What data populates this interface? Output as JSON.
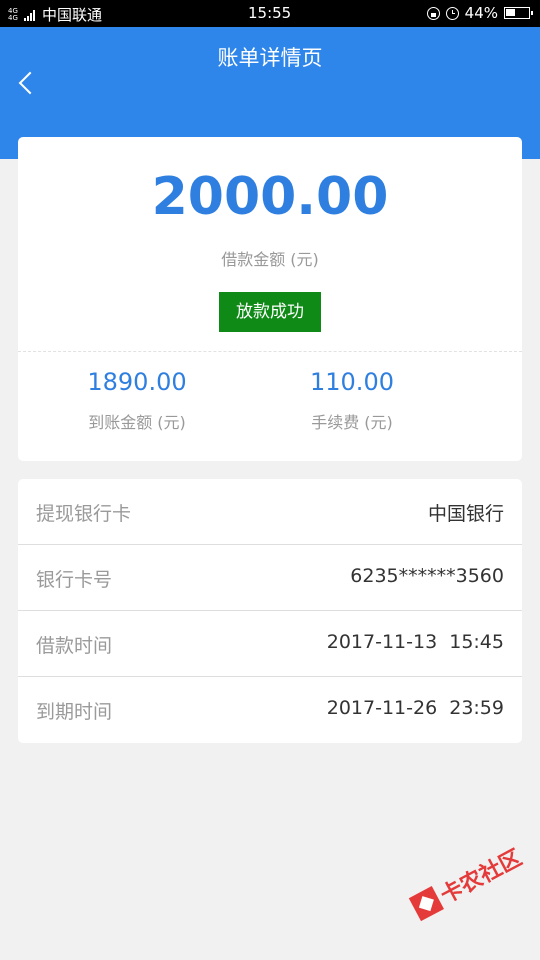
{
  "status_bar": {
    "network_type": "4G 4G",
    "carrier": "中国联通",
    "time": "15:55",
    "battery": "44%",
    "battery_level": 0.44
  },
  "header": {
    "title": "账单详情页"
  },
  "summary": {
    "amount": "2000.00",
    "amount_label": "借款金额 (元)",
    "status": "放款成功",
    "received_amount": "1890.00",
    "received_label": "到账金额 (元)",
    "fee_amount": "110.00",
    "fee_label": "手续费 (元)"
  },
  "details": [
    {
      "label": "提现银行卡",
      "value": "中国银行"
    },
    {
      "label": "银行卡号",
      "value": "6235******3560"
    },
    {
      "label": "借款时间",
      "value": "2017-11-13  15:45"
    },
    {
      "label": "到期时间",
      "value": "2017-11-26  23:59"
    }
  ],
  "watermark": "卡农社区",
  "colors": {
    "header_bg": "#2f86ea",
    "amount_text": "#2f7fe0",
    "status_badge": "#0f8a17",
    "page_bg": "#f1f1f1"
  }
}
